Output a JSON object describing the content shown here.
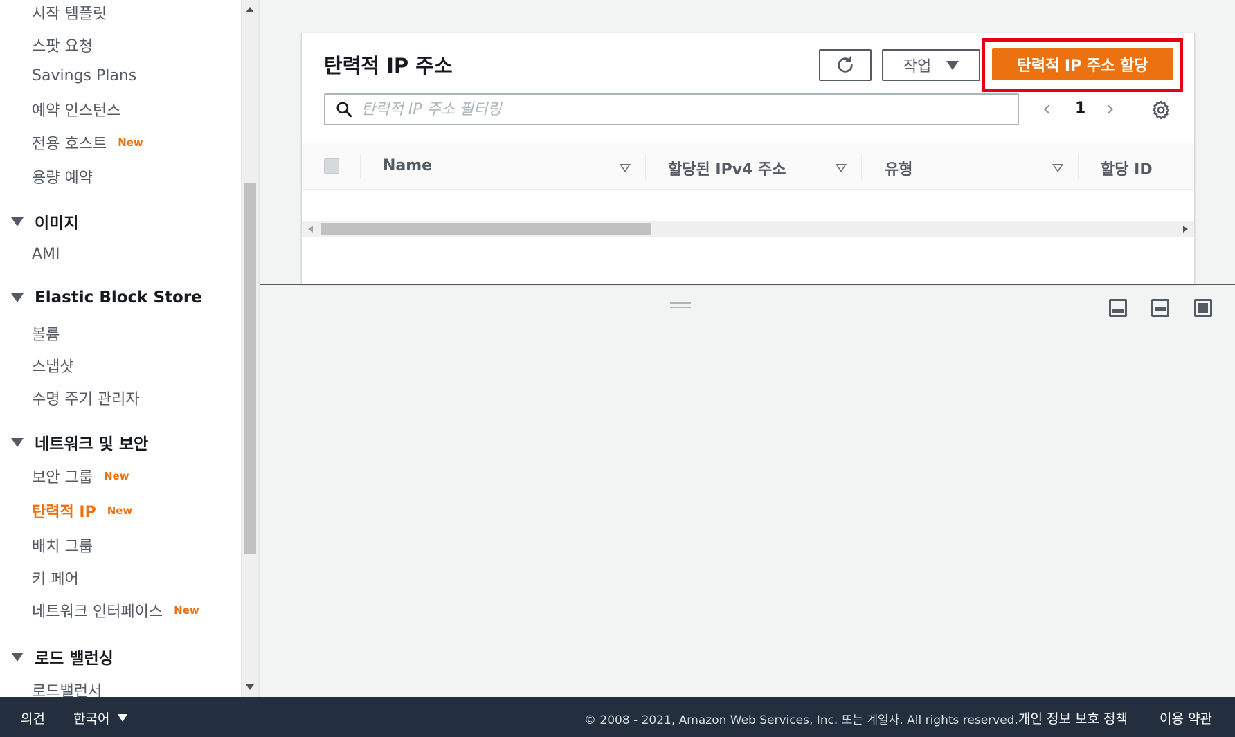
{
  "sidebar": {
    "items_top": [
      {
        "label": "시작 템플릿"
      },
      {
        "label": "스팟 요청"
      },
      {
        "label": "Savings Plans"
      },
      {
        "label": "예약 인스턴스"
      },
      {
        "label": "전용 호스트",
        "badge": "New"
      },
      {
        "label": "용량 예약"
      }
    ],
    "sections": [
      {
        "title": "이미지",
        "items": [
          {
            "label": "AMI"
          }
        ]
      },
      {
        "title": "Elastic Block Store",
        "items": [
          {
            "label": "볼륨"
          },
          {
            "label": "스냅샷"
          },
          {
            "label": "수명 주기 관리자"
          }
        ]
      },
      {
        "title": "네트워크 및 보안",
        "items": [
          {
            "label": "보안 그룹",
            "badge": "New"
          },
          {
            "label": "탄력적 IP",
            "badge": "New",
            "active": true
          },
          {
            "label": "배치 그룹"
          },
          {
            "label": "키 페어"
          },
          {
            "label": "네트워크 인터페이스",
            "badge": "New"
          }
        ]
      },
      {
        "title": "로드 밸런싱",
        "items": [
          {
            "label": "로드밸런서"
          }
        ]
      }
    ]
  },
  "panel": {
    "title": "탄력적 IP 주소",
    "action_label": "작업",
    "primary_label": "탄력적 IP 주소 할당",
    "search_placeholder": "탄력적 IP 주소 필터링",
    "page": "1",
    "columns": [
      "Name",
      "할당된 IPv4 주소",
      "유형",
      "할당 ID"
    ]
  },
  "footer": {
    "feedback": "의견",
    "language": "한국어",
    "copyright": "© 2008 - 2021, Amazon Web Services, Inc. 또는 계열사. All rights reserved.",
    "privacy": "개인 정보 보호 정책",
    "terms": "이용 약관"
  },
  "colors": {
    "accent": "#ec7211",
    "highlight_border": "#e60012",
    "footer_bg": "#232f3e"
  }
}
